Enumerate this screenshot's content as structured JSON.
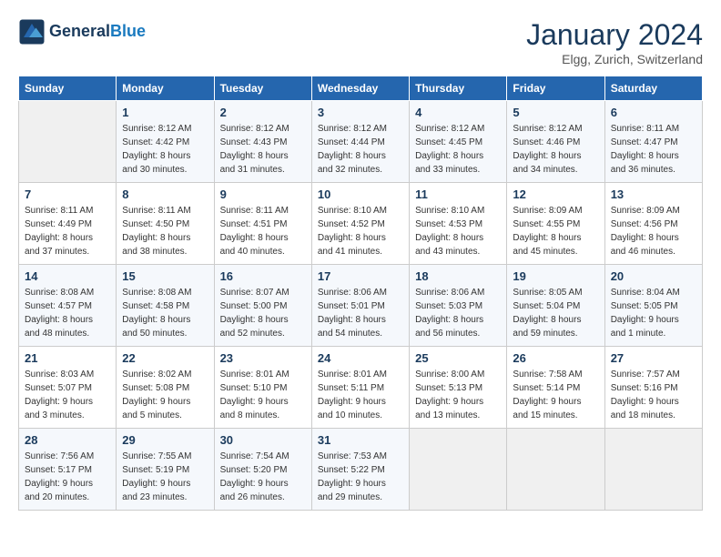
{
  "header": {
    "logo_line1": "General",
    "logo_line2": "Blue",
    "month_title": "January 2024",
    "location": "Elgg, Zurich, Switzerland"
  },
  "weekdays": [
    "Sunday",
    "Monday",
    "Tuesday",
    "Wednesday",
    "Thursday",
    "Friday",
    "Saturday"
  ],
  "weeks": [
    [
      {
        "day": "",
        "info": ""
      },
      {
        "day": "1",
        "info": "Sunrise: 8:12 AM\nSunset: 4:42 PM\nDaylight: 8 hours\nand 30 minutes."
      },
      {
        "day": "2",
        "info": "Sunrise: 8:12 AM\nSunset: 4:43 PM\nDaylight: 8 hours\nand 31 minutes."
      },
      {
        "day": "3",
        "info": "Sunrise: 8:12 AM\nSunset: 4:44 PM\nDaylight: 8 hours\nand 32 minutes."
      },
      {
        "day": "4",
        "info": "Sunrise: 8:12 AM\nSunset: 4:45 PM\nDaylight: 8 hours\nand 33 minutes."
      },
      {
        "day": "5",
        "info": "Sunrise: 8:12 AM\nSunset: 4:46 PM\nDaylight: 8 hours\nand 34 minutes."
      },
      {
        "day": "6",
        "info": "Sunrise: 8:11 AM\nSunset: 4:47 PM\nDaylight: 8 hours\nand 36 minutes."
      }
    ],
    [
      {
        "day": "7",
        "info": "Sunrise: 8:11 AM\nSunset: 4:49 PM\nDaylight: 8 hours\nand 37 minutes."
      },
      {
        "day": "8",
        "info": "Sunrise: 8:11 AM\nSunset: 4:50 PM\nDaylight: 8 hours\nand 38 minutes."
      },
      {
        "day": "9",
        "info": "Sunrise: 8:11 AM\nSunset: 4:51 PM\nDaylight: 8 hours\nand 40 minutes."
      },
      {
        "day": "10",
        "info": "Sunrise: 8:10 AM\nSunset: 4:52 PM\nDaylight: 8 hours\nand 41 minutes."
      },
      {
        "day": "11",
        "info": "Sunrise: 8:10 AM\nSunset: 4:53 PM\nDaylight: 8 hours\nand 43 minutes."
      },
      {
        "day": "12",
        "info": "Sunrise: 8:09 AM\nSunset: 4:55 PM\nDaylight: 8 hours\nand 45 minutes."
      },
      {
        "day": "13",
        "info": "Sunrise: 8:09 AM\nSunset: 4:56 PM\nDaylight: 8 hours\nand 46 minutes."
      }
    ],
    [
      {
        "day": "14",
        "info": "Sunrise: 8:08 AM\nSunset: 4:57 PM\nDaylight: 8 hours\nand 48 minutes."
      },
      {
        "day": "15",
        "info": "Sunrise: 8:08 AM\nSunset: 4:58 PM\nDaylight: 8 hours\nand 50 minutes."
      },
      {
        "day": "16",
        "info": "Sunrise: 8:07 AM\nSunset: 5:00 PM\nDaylight: 8 hours\nand 52 minutes."
      },
      {
        "day": "17",
        "info": "Sunrise: 8:06 AM\nSunset: 5:01 PM\nDaylight: 8 hours\nand 54 minutes."
      },
      {
        "day": "18",
        "info": "Sunrise: 8:06 AM\nSunset: 5:03 PM\nDaylight: 8 hours\nand 56 minutes."
      },
      {
        "day": "19",
        "info": "Sunrise: 8:05 AM\nSunset: 5:04 PM\nDaylight: 8 hours\nand 59 minutes."
      },
      {
        "day": "20",
        "info": "Sunrise: 8:04 AM\nSunset: 5:05 PM\nDaylight: 9 hours\nand 1 minute."
      }
    ],
    [
      {
        "day": "21",
        "info": "Sunrise: 8:03 AM\nSunset: 5:07 PM\nDaylight: 9 hours\nand 3 minutes."
      },
      {
        "day": "22",
        "info": "Sunrise: 8:02 AM\nSunset: 5:08 PM\nDaylight: 9 hours\nand 5 minutes."
      },
      {
        "day": "23",
        "info": "Sunrise: 8:01 AM\nSunset: 5:10 PM\nDaylight: 9 hours\nand 8 minutes."
      },
      {
        "day": "24",
        "info": "Sunrise: 8:01 AM\nSunset: 5:11 PM\nDaylight: 9 hours\nand 10 minutes."
      },
      {
        "day": "25",
        "info": "Sunrise: 8:00 AM\nSunset: 5:13 PM\nDaylight: 9 hours\nand 13 minutes."
      },
      {
        "day": "26",
        "info": "Sunrise: 7:58 AM\nSunset: 5:14 PM\nDaylight: 9 hours\nand 15 minutes."
      },
      {
        "day": "27",
        "info": "Sunrise: 7:57 AM\nSunset: 5:16 PM\nDaylight: 9 hours\nand 18 minutes."
      }
    ],
    [
      {
        "day": "28",
        "info": "Sunrise: 7:56 AM\nSunset: 5:17 PM\nDaylight: 9 hours\nand 20 minutes."
      },
      {
        "day": "29",
        "info": "Sunrise: 7:55 AM\nSunset: 5:19 PM\nDaylight: 9 hours\nand 23 minutes."
      },
      {
        "day": "30",
        "info": "Sunrise: 7:54 AM\nSunset: 5:20 PM\nDaylight: 9 hours\nand 26 minutes."
      },
      {
        "day": "31",
        "info": "Sunrise: 7:53 AM\nSunset: 5:22 PM\nDaylight: 9 hours\nand 29 minutes."
      },
      {
        "day": "",
        "info": ""
      },
      {
        "day": "",
        "info": ""
      },
      {
        "day": "",
        "info": ""
      }
    ]
  ]
}
